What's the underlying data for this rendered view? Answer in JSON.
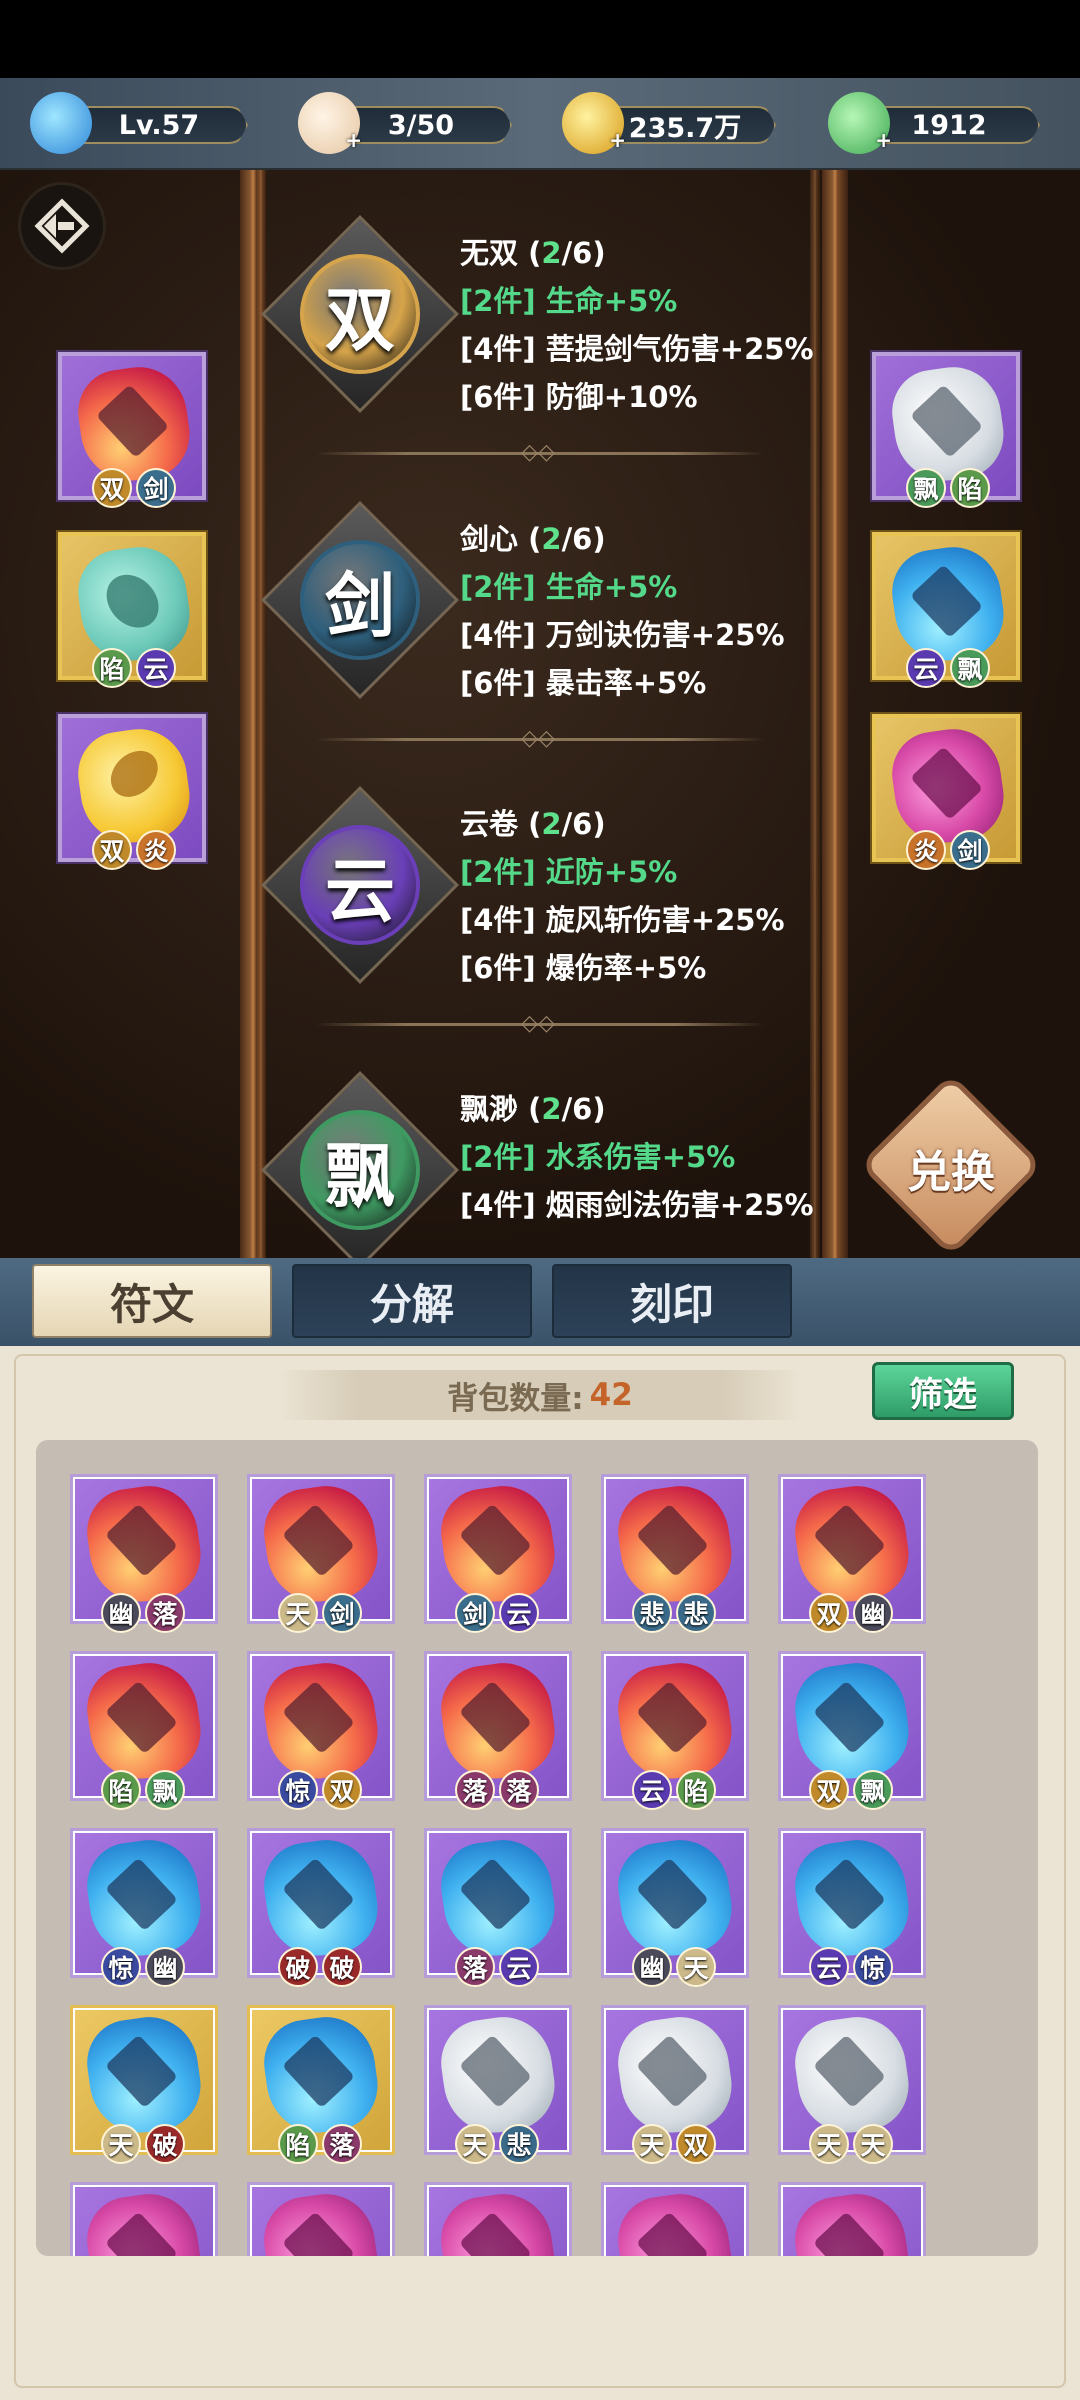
{
  "topbar": {
    "level": "Lv.57",
    "stamina": "3/50",
    "coins": "235.7万",
    "gems": "1912"
  },
  "sets": [
    {
      "char": "双",
      "name": "无双",
      "count": "2",
      "total": "6",
      "color": "#d6a44a",
      "bonuses": [
        {
          "text": "[2件] 生命+5%",
          "active": true
        },
        {
          "text": "[4件] 菩提剑气伤害+25%",
          "active": false
        },
        {
          "text": "[6件] 防御+10%",
          "active": false
        }
      ]
    },
    {
      "char": "剑",
      "name": "剑心",
      "count": "2",
      "total": "6",
      "color": "#2e5f7c",
      "bonuses": [
        {
          "text": "[2件] 生命+5%",
          "active": true
        },
        {
          "text": "[4件] 万剑诀伤害+25%",
          "active": false
        },
        {
          "text": "[6件] 暴击率+5%",
          "active": false
        }
      ]
    },
    {
      "char": "云",
      "name": "云卷",
      "count": "2",
      "total": "6",
      "color": "#6a3fb8",
      "bonuses": [
        {
          "text": "[2件] 近防+5%",
          "active": true
        },
        {
          "text": "[4件] 旋风斩伤害+25%",
          "active": false
        },
        {
          "text": "[6件] 爆伤率+5%",
          "active": false
        }
      ]
    },
    {
      "char": "飘",
      "name": "飘渺",
      "count": "2",
      "total": "6",
      "color": "#3f9a62",
      "bonuses": [
        {
          "text": "[2件] 水系伤害+5%",
          "active": true
        },
        {
          "text": "[4件] 烟雨剑法伤害+25%",
          "active": false
        }
      ]
    }
  ],
  "separator": "/",
  "equipped_left": [
    {
      "gem": "red",
      "frame": "purple",
      "tags": [
        "双",
        "剑"
      ]
    },
    {
      "gem": "mint",
      "frame": "gold",
      "tags": [
        "陷",
        "云"
      ]
    },
    {
      "gem": "yellow",
      "frame": "purple",
      "tags": [
        "双",
        "炎"
      ]
    }
  ],
  "equipped_right": [
    {
      "gem": "white",
      "frame": "purple",
      "tags": [
        "飘",
        "陷"
      ]
    },
    {
      "gem": "blue",
      "frame": "gold",
      "tags": [
        "云",
        "飘"
      ]
    },
    {
      "gem": "magenta",
      "frame": "gold",
      "tags": [
        "炎",
        "剑"
      ]
    }
  ],
  "exchange_label": "兑换",
  "tabs": [
    "符文",
    "分解",
    "刻印"
  ],
  "bag": {
    "label": "背包数量:",
    "count": "42"
  },
  "filter_label": "筛选",
  "tag_colors": {
    "双": "#c08a2a",
    "剑": "#3a6e8c",
    "陷": "#5a9a4a",
    "云": "#5a3ab0",
    "炎": "#c8722a",
    "飘": "#4a9a5a",
    "幽": "#4a4a5a",
    "落": "#8a3a6a",
    "天": "#cbb98a",
    "悲": "#3a6a8a",
    "惊": "#3a4aa0",
    "破": "#9a2a2a"
  },
  "inventory": [
    {
      "gem": "red",
      "frame": "purple",
      "tags": [
        "幽",
        "落"
      ]
    },
    {
      "gem": "red",
      "frame": "purple",
      "tags": [
        "天",
        "剑"
      ]
    },
    {
      "gem": "red",
      "frame": "purple",
      "tags": [
        "剑",
        "云"
      ]
    },
    {
      "gem": "red",
      "frame": "purple",
      "tags": [
        "悲",
        "悲"
      ]
    },
    {
      "gem": "red",
      "frame": "purple",
      "tags": [
        "双",
        "幽"
      ]
    },
    {
      "gem": "red",
      "frame": "purple",
      "tags": [
        "陷",
        "飘"
      ]
    },
    {
      "gem": "red",
      "frame": "purple",
      "tags": [
        "惊",
        "双"
      ]
    },
    {
      "gem": "red",
      "frame": "purple",
      "tags": [
        "落",
        "落"
      ]
    },
    {
      "gem": "red",
      "frame": "purple",
      "tags": [
        "云",
        "陷"
      ]
    },
    {
      "gem": "blue",
      "frame": "purple",
      "tags": [
        "双",
        "飘"
      ]
    },
    {
      "gem": "blue",
      "frame": "purple",
      "tags": [
        "惊",
        "幽"
      ]
    },
    {
      "gem": "blue",
      "frame": "purple",
      "tags": [
        "破",
        "破"
      ]
    },
    {
      "gem": "blue",
      "frame": "purple",
      "tags": [
        "落",
        "云"
      ]
    },
    {
      "gem": "blue",
      "frame": "purple",
      "tags": [
        "幽",
        "天"
      ]
    },
    {
      "gem": "blue",
      "frame": "purple",
      "tags": [
        "云",
        "惊"
      ]
    },
    {
      "gem": "blue",
      "frame": "gold",
      "tags": [
        "天",
        "破"
      ]
    },
    {
      "gem": "blue",
      "frame": "gold",
      "tags": [
        "陷",
        "落"
      ]
    },
    {
      "gem": "white",
      "frame": "purple",
      "tags": [
        "天",
        "悲"
      ]
    },
    {
      "gem": "white",
      "frame": "purple",
      "tags": [
        "天",
        "双"
      ]
    },
    {
      "gem": "white",
      "frame": "purple",
      "tags": [
        "天",
        "天"
      ]
    },
    {
      "gem": "magenta",
      "frame": "purple",
      "tags": []
    },
    {
      "gem": "magenta",
      "frame": "purple",
      "tags": []
    },
    {
      "gem": "magenta",
      "frame": "purple",
      "tags": []
    },
    {
      "gem": "magenta",
      "frame": "purple",
      "tags": []
    },
    {
      "gem": "magenta",
      "frame": "purple",
      "tags": []
    }
  ]
}
